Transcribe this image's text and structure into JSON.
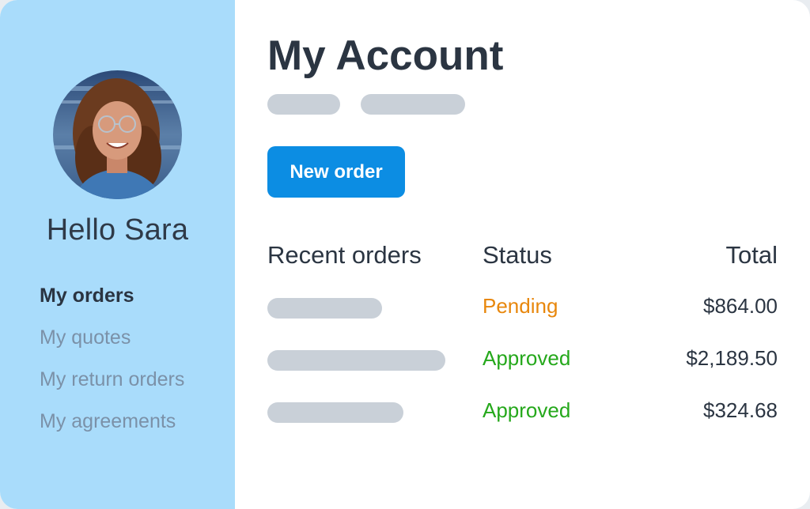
{
  "sidebar": {
    "greeting": "Hello Sara",
    "nav": [
      {
        "label": "My orders",
        "active": true
      },
      {
        "label": "My quotes",
        "active": false
      },
      {
        "label": "My return orders",
        "active": false
      },
      {
        "label": "My agreements",
        "active": false
      }
    ]
  },
  "main": {
    "title": "My Account",
    "new_order_label": "New order",
    "table": {
      "headers": {
        "orders": "Recent orders",
        "status": "Status",
        "total": "Total"
      },
      "rows": [
        {
          "status": "Pending",
          "status_kind": "pending",
          "total": "$864.00"
        },
        {
          "status": "Approved",
          "status_kind": "approved",
          "total": "$2,189.50"
        },
        {
          "status": "Approved",
          "status_kind": "approved",
          "total": "$324.68"
        }
      ]
    }
  },
  "colors": {
    "sidebar_bg": "#a9dcfb",
    "primary_button": "#0c8de3",
    "pending": "#e8870c",
    "approved": "#25a81b",
    "placeholder": "#c9d0d8"
  }
}
